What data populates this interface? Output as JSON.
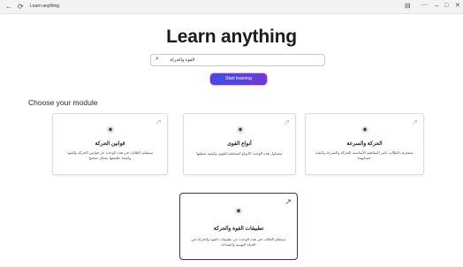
{
  "window": {
    "title": "Learn anything",
    "controls": [
      "⊟",
      "···",
      "–",
      "□",
      "✕"
    ]
  },
  "page": {
    "heading": "Learn anything",
    "module_heading": "Choose your module"
  },
  "search": {
    "value": "القوة والحركة",
    "icon": "search-icon"
  },
  "start_button": {
    "label": "Start learning",
    "accent": "#4f46e5"
  },
  "modules": [
    {
      "title": "قوانين الحركة",
      "description": "سيتعلم الطالب في هذه الوحدة عن قوانين الحركة والقوة وكيفية تطبيقها بشكل صحيح"
    },
    {
      "title": "أنواع القوى",
      "description": "ستتناول هذه الوحدة الأنواع المختلفة للقوى وكيفية تحليلها"
    },
    {
      "title": "الحركة والسرعة",
      "description": "ستتعرف الطالب على المفاهيم الأساسية للحركة والسرعة وكيفية حسابهما"
    },
    {
      "title": "تطبيقات القوة والحركة",
      "description": "سيتعلم الطالب في هذه الوحدة عن تطبيقات القوة والحركة في الحياة اليومية والصناعة"
    }
  ]
}
